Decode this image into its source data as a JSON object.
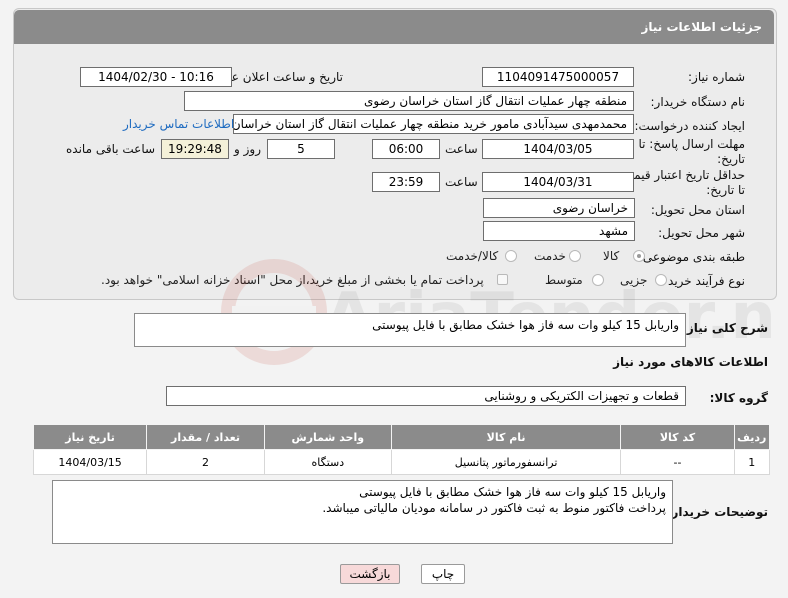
{
  "header": {
    "title": "جزئیات اطلاعات نیاز"
  },
  "fields": {
    "need_number": {
      "label": "شماره نیاز:",
      "value": "1104091475000057"
    },
    "announce_datetime": {
      "label": "تاریخ و ساعت اعلان عمومی:",
      "value": "1404/02/30 - 10:16"
    },
    "buyer_org": {
      "label": "نام دستگاه خریدار:",
      "value": "منطقه چهار عملیات انتقال گاز    استان خراسان رضوی"
    },
    "creator": {
      "label": "ایجاد کننده درخواست:",
      "value": "محمدمهدی سیدآبادی مامور خرید منطقه چهار عملیات انتقال گاز    استان خراسان رضوی",
      "contact_link": "اطلاعات تماس خریدار"
    },
    "reply_deadline": {
      "label_line1": "مهلت ارسال پاسخ: تا",
      "label_line2": "تاریخ:",
      "date": "1404/03/05",
      "time_label": "ساعت",
      "time": "06:00",
      "days": "5",
      "days_label": "روز و",
      "remaining": "19:29:48",
      "remaining_label": "ساعت باقی مانده"
    },
    "price_validity": {
      "label_line1": "حداقل تاریخ اعتبار قیمت:",
      "label_line2": "تا تاریخ:",
      "date": "1404/03/31",
      "time_label": "ساعت",
      "time": "23:59"
    },
    "delivery_province": {
      "label": "استان محل تحویل:",
      "value": "خراسان رضوی"
    },
    "delivery_city": {
      "label": "شهر محل تحویل:",
      "value": "مشهد"
    },
    "category": {
      "label": "طبقه بندی موضوعی:",
      "options": [
        "کالا",
        "خدمت",
        "کالا/خدمت"
      ],
      "selected": "کالا"
    },
    "process_type": {
      "label": "نوع فرآیند خرید :",
      "options": [
        "جزیی",
        "متوسط"
      ],
      "payment_note": "پرداخت تمام یا بخشی از مبلغ خرید،از محل \"اسناد خزانه اسلامی\" خواهد بود."
    }
  },
  "description": {
    "label": "شرح کلی نیاز:",
    "value": "واریابل 15 کیلو وات سه فاز هوا خشک مطابق با فایل پیوستی"
  },
  "goods_section": {
    "title": "اطلاعات کالاهای مورد نیاز",
    "group_label": "گروه کالا:",
    "group_value": "قطعات و تجهیزات الکتریکی و روشنایی"
  },
  "table": {
    "headers": [
      "ردیف",
      "کد کالا",
      "نام کالا",
      "واحد شمارش",
      "تعداد / مقدار",
      "تاریخ نیاز"
    ],
    "rows": [
      [
        "1",
        "--",
        "ترانسفورماتور پتانسیل",
        "دستگاه",
        "2",
        "1404/03/15"
      ]
    ]
  },
  "buyer_notes": {
    "label": "توضیحات خریدار:",
    "line1": "واریابل 15 کیلو وات سه فاز هوا خشک مطابق با فایل پیوستی",
    "line2": "پرداخت فاکتور منوط به ثبت فاکتور در سامانه مودیان مالیاتی میباشد."
  },
  "buttons": {
    "print": "چاپ",
    "back": "بازگشت"
  },
  "watermark": {
    "text": "AriaTender.neT"
  },
  "colors": {
    "header_bg": "#8b8b8b",
    "link": "#1e6bc0",
    "back_button_bg": "#f7d9d9"
  }
}
